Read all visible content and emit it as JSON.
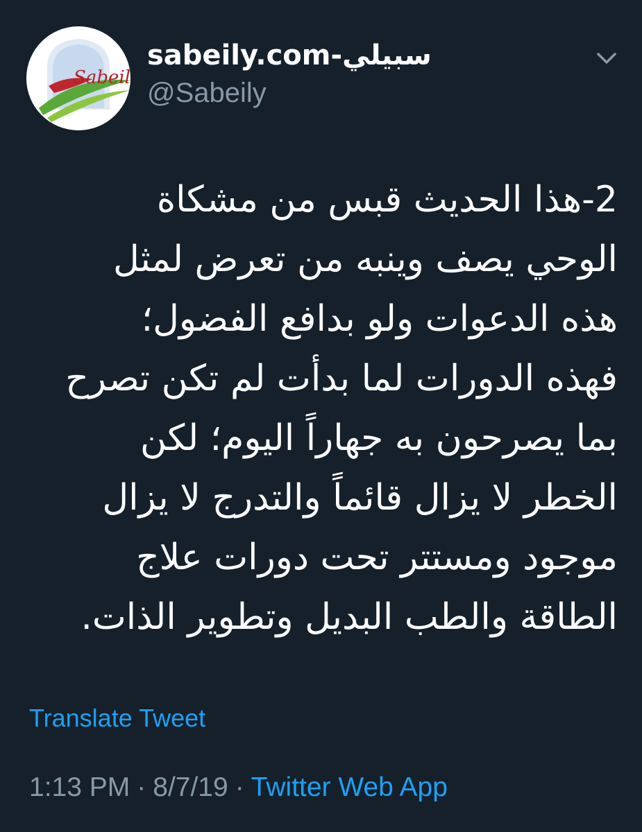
{
  "tweet": {
    "author": {
      "display_name": "sabeily.com-سبيلي",
      "handle": "@Sabeily",
      "avatar_icon": "sabeily-logo-avatar",
      "avatar_text": "Sabeily"
    },
    "menu_icon": "chevron-down-icon",
    "text": "2-هذا الحديث  قبس من مشكاة\nالوحي يصف وينبه من تعرض لمثل\nهذه الدعوات ولو بدافع الفضول؛\nفهذه الدورات لما بدأت لم تكن تصرح\nبما يصرحون به جهاراً اليوم؛ لكن\nالخطر لا يزال قائماً والتدرج لا يزال\nموجود ومستتر تحت دورات علاج\nالطاقة والطب البديل وتطوير الذات.",
    "translate_label": "Translate Tweet",
    "time": "1:13 PM",
    "date": "8/7/19",
    "separator": "·",
    "source": "Twitter Web App"
  },
  "colors": {
    "background": "#15202b",
    "primary_text": "#ffffff",
    "secondary_text": "#8899a6",
    "link": "#1da1f2"
  }
}
